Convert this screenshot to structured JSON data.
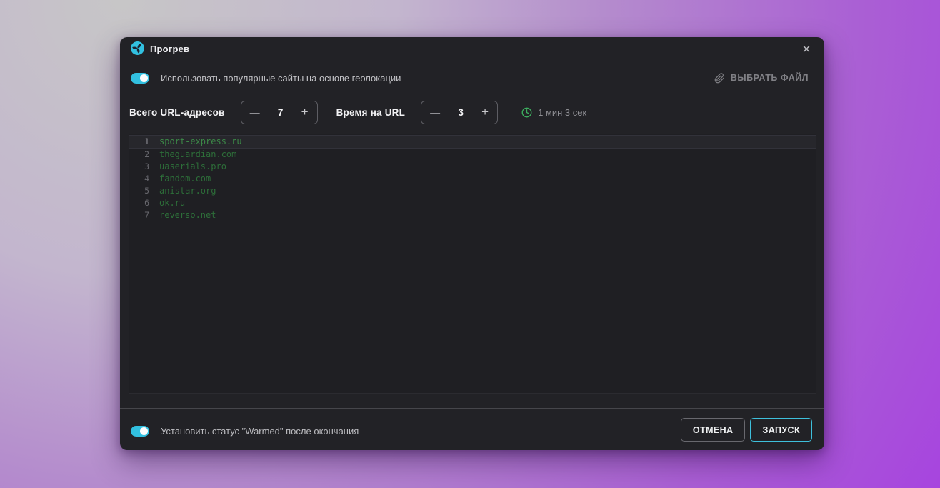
{
  "window": {
    "title": "Прогрев",
    "close_glyph": "✕"
  },
  "colors": {
    "accent": "#32c0e0",
    "clock_green": "#3cae5e",
    "url_green": "#2d6e39"
  },
  "header": {
    "geo_toggle_label": "Использовать популярные сайты на основе геолокации",
    "geo_toggle_state": "on",
    "choose_file_label": "ВЫБРАТЬ ФАЙЛ"
  },
  "steppers": {
    "total_urls": {
      "label": "Всего URL-адресов",
      "value": "7",
      "minus_glyph": "—",
      "plus_glyph": "+"
    },
    "time_per_url": {
      "label": "Время на URL",
      "value": "3",
      "minus_glyph": "—",
      "plus_glyph": "+"
    },
    "estimated_time": "1 мин 3 сек"
  },
  "editor": {
    "lines": [
      {
        "num": "1",
        "url": "sport-express.ru"
      },
      {
        "num": "2",
        "url": "theguardian.com"
      },
      {
        "num": "3",
        "url": "uaserials.pro"
      },
      {
        "num": "4",
        "url": "fandom.com"
      },
      {
        "num": "5",
        "url": "anistar.org"
      },
      {
        "num": "6",
        "url": "ok.ru"
      },
      {
        "num": "7",
        "url": "reverso.net"
      }
    ]
  },
  "footer": {
    "warmed_toggle_label": "Установить статус \"Warmed\" после окончания",
    "warmed_toggle_state": "on",
    "cancel_label": "ОТМЕНА",
    "start_label": "ЗАПУСК"
  }
}
